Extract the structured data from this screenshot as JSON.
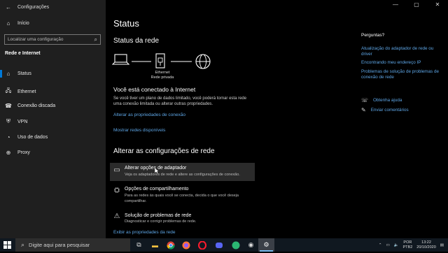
{
  "window": {
    "title": "Configurações",
    "controls": [
      "—",
      "▢",
      "✕"
    ]
  },
  "sidebar": {
    "home_label": "Início",
    "search_placeholder": "Localizar uma configuração",
    "section_title": "Rede e Internet",
    "items": [
      {
        "label": "Status",
        "icon": "home-network-icon",
        "active": true
      },
      {
        "label": "Ethernet",
        "icon": "ethernet-icon",
        "active": false
      },
      {
        "label": "Conexão discada",
        "icon": "dialup-icon",
        "active": false
      },
      {
        "label": "VPN",
        "icon": "vpn-icon",
        "active": false
      },
      {
        "label": "Uso de dados",
        "icon": "data-usage-icon",
        "active": false
      },
      {
        "label": "Proxy",
        "icon": "globe-icon",
        "active": false
      }
    ]
  },
  "main": {
    "title": "Status",
    "network_status_heading": "Status da rede",
    "diagram": {
      "label_line1": "Ethernet",
      "label_line2": "Rede privada"
    },
    "connected_heading": "Você está conectado à Internet",
    "connected_desc_line1": "Se você tiver um plano de dados limitado, você poderá tornar esta rede",
    "connected_desc_line2": "uma conexão limitada ou alterar outras propriedades.",
    "link_change_properties": "Alterar as propriedades de conexão",
    "link_show_networks": "Mostrar redes disponíveis",
    "change_settings_heading": "Alterar as configurações de rede",
    "options": [
      {
        "title": "Alterar opções de adaptador",
        "desc": [
          "Veja os adaptadores de rede e altere as configurações de conexão."
        ],
        "icon": "adapter-icon"
      },
      {
        "title": "Opções de compartilhamento",
        "desc": [
          "Para as redes às quais você se conecta, decida o que você deseja",
          "compartilhar."
        ],
        "icon": "sharing-icon"
      },
      {
        "title": "Solução de problemas de rede",
        "desc": [
          "Diagnosticar e corrigir problemas de rede."
        ],
        "icon": "warning-icon"
      }
    ],
    "link_show_hardware": "Exibir as propriedades da rede"
  },
  "right": {
    "questions_heading": "Perguntas?",
    "links": [
      [
        "Atualização do adaptador de rede ou",
        "driver"
      ],
      [
        "Encontrando meu endereço IP"
      ],
      [
        "Problemas de solução de problemas de",
        "conexão de rede"
      ]
    ],
    "help_link": "Obtenha ajuda",
    "feedback_link": "Enviar comentários"
  },
  "taskbar": {
    "search_placeholder": "Digite aqui para pesquisar",
    "lang_line1": "POR",
    "lang_line2": "PTB2",
    "time": "13:22",
    "date": "20/10/2020"
  },
  "colors": {
    "accent": "#0078d7",
    "link": "#5ea6e6",
    "sidebar_bg": "#1f1f1f"
  }
}
